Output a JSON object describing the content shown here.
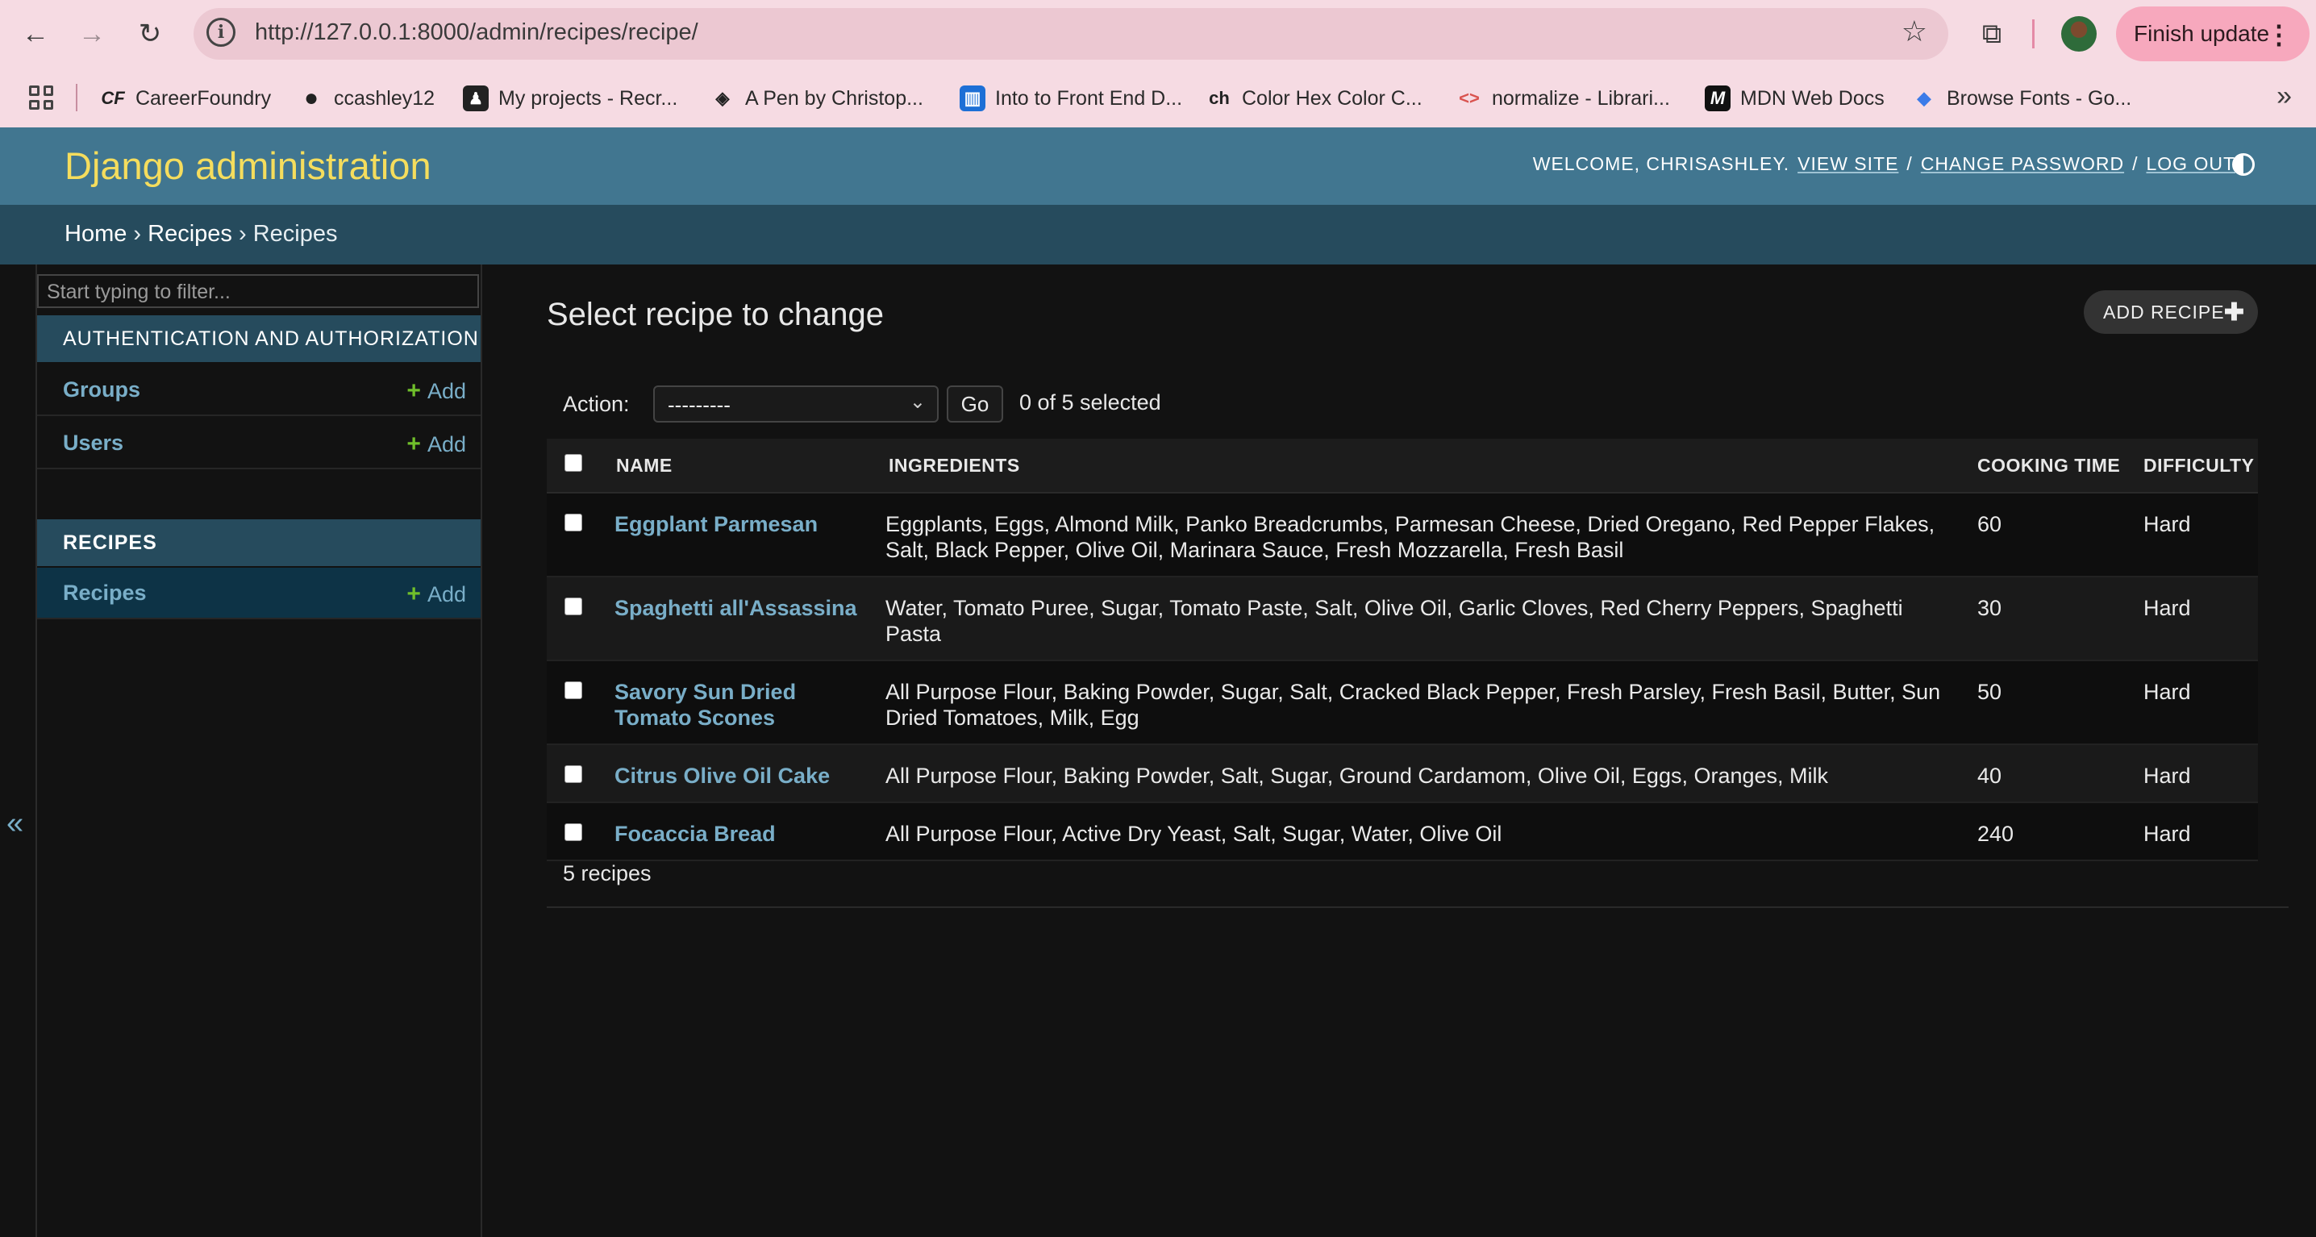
{
  "browser": {
    "url": "http://127.0.0.1:8000/admin/recipes/recipe/",
    "finish_update_label": "Finish update",
    "bookmarks": [
      {
        "label": "CareerFoundry",
        "icon": "careerfoundry-icon",
        "glyph": "CF"
      },
      {
        "label": "ccashley12",
        "icon": "github-icon",
        "glyph": "●"
      },
      {
        "label": "My projects - Recr...",
        "icon": "recruit-icon",
        "glyph": "♟"
      },
      {
        "label": "A Pen by Christop...",
        "icon": "codepen-icon",
        "glyph": "◈"
      },
      {
        "label": "Into to Front End D...",
        "icon": "trello-icon",
        "glyph": "▥"
      },
      {
        "label": "Color Hex Color C...",
        "icon": "colorhex-icon",
        "glyph": "ch"
      },
      {
        "label": "normalize - Librari...",
        "icon": "code-brackets-icon",
        "glyph": "<>"
      },
      {
        "label": "MDN Web Docs",
        "icon": "mdn-icon",
        "glyph": "M"
      },
      {
        "label": "Browse Fonts - Go...",
        "icon": "google-fonts-icon",
        "glyph": "◆"
      }
    ]
  },
  "header": {
    "branding": "Django administration",
    "welcome": "WELCOME, CHRISASHLEY.",
    "view_site": "VIEW SITE",
    "change_password": "CHANGE PASSWORD",
    "log_out": "LOG OUT",
    "separator": "/"
  },
  "breadcrumbs": {
    "home": "Home",
    "app": "Recipes",
    "model": "Recipes",
    "sep": "›"
  },
  "sidebar": {
    "filter_placeholder": "Start typing to filter...",
    "modules": [
      {
        "caption": "AUTHENTICATION AND AUTHORIZATION",
        "models": [
          {
            "name": "Groups",
            "add": "Add"
          },
          {
            "name": "Users",
            "add": "Add"
          }
        ]
      },
      {
        "caption": "RECIPES",
        "models": [
          {
            "name": "Recipes",
            "add": "Add"
          }
        ]
      }
    ],
    "collapse_glyph": "«"
  },
  "content": {
    "title": "Select recipe to change",
    "add_button": "ADD RECIPE",
    "action_label": "Action:",
    "action_selected": "---------",
    "go_label": "Go",
    "selected_count": "0 of 5 selected",
    "columns": [
      "NAME",
      "INGREDIENTS",
      "COOKING TIME",
      "DIFFICULTY"
    ],
    "rows": [
      {
        "name": "Eggplant Parmesan",
        "ingredients": "Eggplants, Eggs, Almond Milk, Panko Breadcrumbs, Parmesan Cheese, Dried Oregano, Red Pepper Flakes, Salt, Black Pepper, Olive Oil, Marinara Sauce, Fresh Mozzarella, Fresh Basil",
        "cooking_time": "60",
        "difficulty": "Hard"
      },
      {
        "name": "Spaghetti all'Assassina",
        "ingredients": "Water, Tomato Puree, Sugar, Tomato Paste, Salt, Olive Oil, Garlic Cloves, Red Cherry Peppers, Spaghetti Pasta",
        "cooking_time": "30",
        "difficulty": "Hard"
      },
      {
        "name": "Savory Sun Dried Tomato Scones",
        "ingredients": "All Purpose Flour, Baking Powder, Sugar, Salt, Cracked Black Pepper, Fresh Parsley, Fresh Basil, Butter, Sun Dried Tomatoes, Milk, Egg",
        "cooking_time": "50",
        "difficulty": "Hard"
      },
      {
        "name": "Citrus Olive Oil Cake",
        "ingredients": "All Purpose Flour, Baking Powder, Salt, Sugar, Ground Cardamom, Olive Oil, Eggs, Oranges, Milk",
        "cooking_time": "40",
        "difficulty": "Hard"
      },
      {
        "name": "Focaccia Bread",
        "ingredients": "All Purpose Flour, Active Dry Yeast, Salt, Sugar, Water, Olive Oil",
        "cooking_time": "240",
        "difficulty": "Hard"
      }
    ],
    "paginator": "5 recipes"
  },
  "colors": {
    "header_bg": "#417690",
    "branding": "#f5dd5d",
    "breadcrumbs_bg": "#264b5d",
    "link": "#79aec8",
    "add_plus": "#70bf2b",
    "chrome_bg": "#f6dbe3"
  }
}
